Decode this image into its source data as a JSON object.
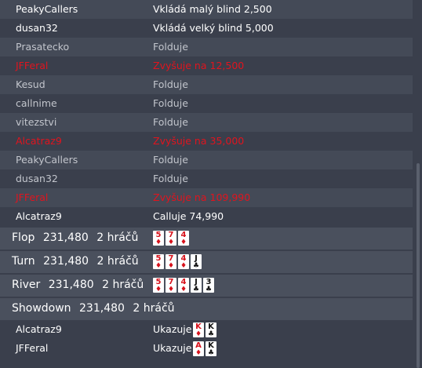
{
  "actions": [
    {
      "player": "PeakyCallers",
      "action": "Vkládá malý blind 2,500",
      "kind": "call"
    },
    {
      "player": "dusan32",
      "action": "Vkládá velký blind 5,000",
      "kind": "call"
    },
    {
      "player": "Prasatecko",
      "action": "Folduje",
      "kind": "fold"
    },
    {
      "player": "JFFeral",
      "action": "Zvyšuje na 12,500",
      "kind": "raise"
    },
    {
      "player": "Kesud",
      "action": "Folduje",
      "kind": "fold"
    },
    {
      "player": "callnime",
      "action": "Folduje",
      "kind": "fold"
    },
    {
      "player": "vitezstvi",
      "action": "Folduje",
      "kind": "fold"
    },
    {
      "player": "Alcatraz9",
      "action": "Zvyšuje na 35,000",
      "kind": "raise"
    },
    {
      "player": "PeakyCallers",
      "action": "Folduje",
      "kind": "fold"
    },
    {
      "player": "dusan32",
      "action": "Folduje",
      "kind": "fold"
    },
    {
      "player": "JFFeral",
      "action": "Zvyšuje na 109,990",
      "kind": "raise"
    },
    {
      "player": "Alcatraz9",
      "action": "Calluje 74,990",
      "kind": "call"
    }
  ],
  "streets": {
    "flop": {
      "name": "Flop",
      "pot": "231,480",
      "players": "2 hráčů"
    },
    "turn": {
      "name": "Turn",
      "pot": "231,480",
      "players": "2 hráčů"
    },
    "river": {
      "name": "River",
      "pot": "231,480",
      "players": "2 hráčů"
    },
    "showdown": {
      "name": "Showdown",
      "pot": "231,480",
      "players": "2 hráčů"
    }
  },
  "board": [
    {
      "rank": "5",
      "suit": "♦",
      "color": "red",
      "icon": "five-of-diamonds-icon"
    },
    {
      "rank": "7",
      "suit": "♦",
      "color": "red",
      "icon": "seven-of-diamonds-icon"
    },
    {
      "rank": "4",
      "suit": "♦",
      "color": "red",
      "icon": "four-of-diamonds-icon"
    },
    {
      "rank": "J",
      "suit": "♣",
      "color": "black",
      "icon": "jack-of-clubs-icon"
    },
    {
      "rank": "3",
      "suit": "♣",
      "color": "black",
      "icon": "three-of-clubs-icon"
    }
  ],
  "showdown": [
    {
      "player": "Alcatraz9",
      "action": "Ukazuje",
      "cards": [
        {
          "rank": "K",
          "suit": "♦",
          "color": "red",
          "icon": "king-of-diamonds-icon"
        },
        {
          "rank": "K",
          "suit": "♣",
          "color": "black",
          "icon": "king-of-clubs-icon"
        }
      ]
    },
    {
      "player": "JFFeral",
      "action": "Ukazuje",
      "cards": [
        {
          "rank": "A",
          "suit": "♦",
          "color": "red",
          "icon": "ace-of-diamonds-icon"
        },
        {
          "rank": "K",
          "suit": "♣",
          "color": "black",
          "icon": "king-of-clubs-icon"
        }
      ]
    }
  ],
  "colors": {
    "background": "#3a3f4c",
    "raise": "#e0141e",
    "fold": "#c2c5cc",
    "call": "#ffffff"
  }
}
